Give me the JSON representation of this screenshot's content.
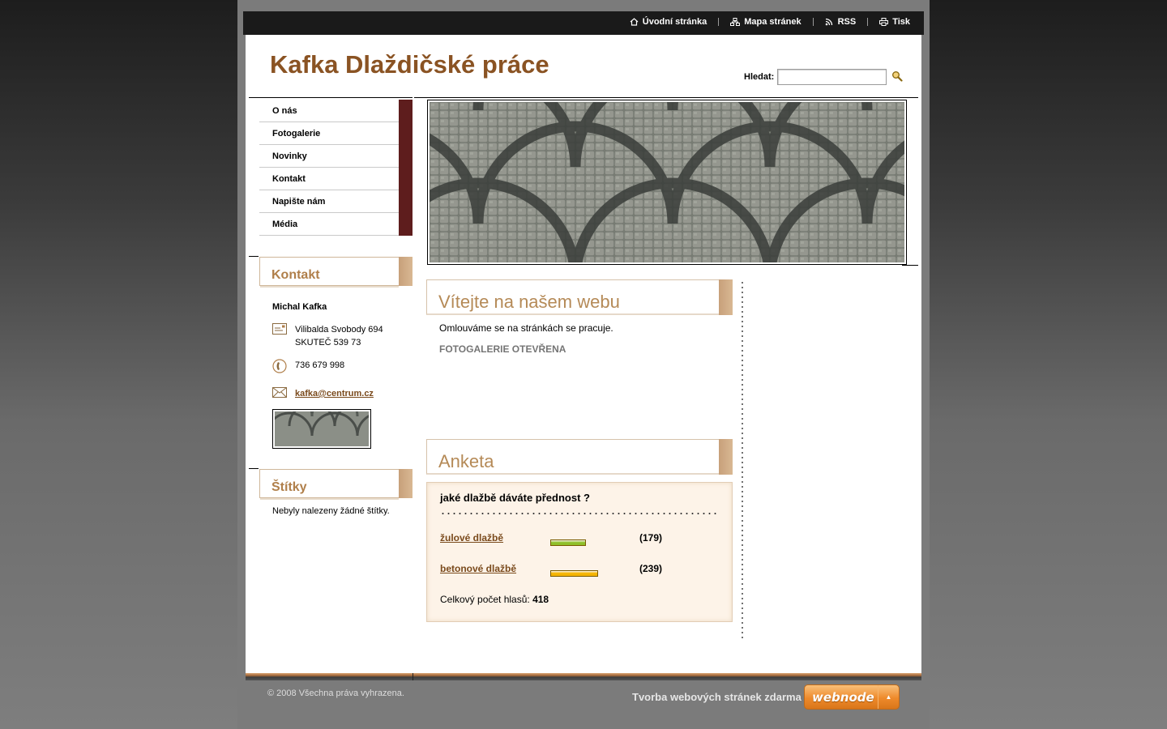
{
  "topnav": {
    "home": "Úvodní stránka",
    "sitemap": "Mapa stránek",
    "rss": "RSS",
    "print": "Tisk"
  },
  "header": {
    "title": "Kafka Dlaždičské práce",
    "search_label": "Hledat:",
    "search_value": "",
    "search_icon": "magnifier-icon"
  },
  "menu": {
    "items": [
      "O nás",
      "Fotogalerie",
      "Novinky",
      "Kontakt",
      "Napište nám",
      "Média"
    ]
  },
  "contact": {
    "heading": "Kontakt",
    "name": "Michal Kafka",
    "address_line1": "Vilibalda Svobody 694",
    "address_line2": "SKUTEČ 539 73",
    "phone": "736 679 998",
    "email": "kafka@centrum.cz"
  },
  "tags": {
    "heading": "Štítky",
    "empty_text": "Nebyly nalezeny žádné štítky."
  },
  "welcome": {
    "heading": "Vítejte na našem webu",
    "text": "Omlouváme se na stránkách se pracuje.",
    "subtext": "FOTOGALERIE OTEVŘENA"
  },
  "poll": {
    "heading": "Anketa",
    "question": "jaké dlažbě dáváte přednost ?",
    "answers": [
      {
        "label": "žulové dlažbě",
        "votes": "(179)",
        "share": 0.428,
        "color": "#8fbf2a"
      },
      {
        "label": "betonové dlažbě",
        "votes": "(239)",
        "share": 0.572,
        "color": "#f5b400"
      }
    ],
    "total_label": "Celkový počet hlasů:",
    "total_value": "418"
  },
  "footer": {
    "copyright": "© 2008 Všechna práva vyhrazena.",
    "link_text": "Tvorba webových stránek zdarma",
    "badge": "webnode"
  },
  "colors": {
    "title": "#8a5323",
    "menu_tab": "#5e1d1d",
    "accent_heading": "#b58a57",
    "link": "#7a4a1c"
  }
}
